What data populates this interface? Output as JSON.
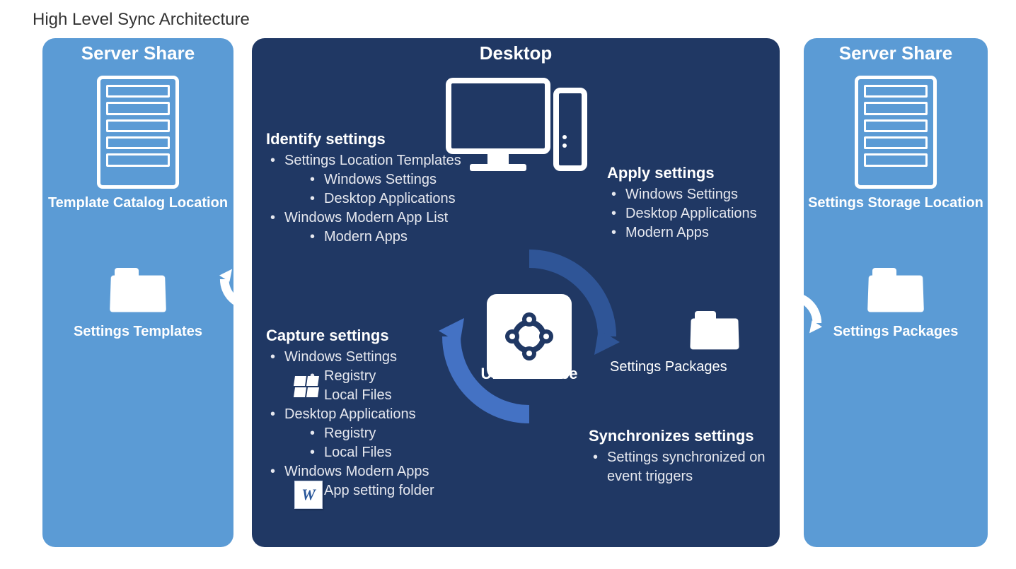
{
  "page_title": "High Level Sync Architecture",
  "left_panel": {
    "title": "Server Share",
    "top_label": "Template Catalog Location",
    "bottom_label": "Settings Templates"
  },
  "right_panel": {
    "title": "Server Share",
    "top_label": "Settings Storage Location",
    "bottom_label": "Settings Packages"
  },
  "center_panel": {
    "title": "Desktop",
    "uev_label": "UE-V Service",
    "settings_packages_label": "Settings Packages",
    "identify": {
      "title": "Identify settings",
      "items": [
        {
          "label": "Settings Location Templates",
          "children": [
            {
              "label": "Windows Settings"
            },
            {
              "label": "Desktop Applications"
            }
          ]
        },
        {
          "label": "Windows Modern App List",
          "children": [
            {
              "label": "Modern Apps"
            }
          ]
        }
      ]
    },
    "capture": {
      "title": "Capture settings",
      "items": [
        {
          "label": "Windows Settings",
          "icon": "windows-flag-icon",
          "children": [
            {
              "label": "Registry"
            },
            {
              "label": "Local Files"
            }
          ]
        },
        {
          "label": "Desktop Applications",
          "icon": "word-document-icon",
          "children": [
            {
              "label": "Registry"
            },
            {
              "label": "Local Files"
            }
          ]
        },
        {
          "label": "Windows Modern Apps",
          "children": [
            {
              "label": "App setting folder"
            }
          ]
        }
      ]
    },
    "apply": {
      "title": "Apply settings",
      "items": [
        {
          "label": "Windows Settings"
        },
        {
          "label": "Desktop Applications"
        },
        {
          "label": "Modern Apps"
        }
      ]
    },
    "sync": {
      "title": "Synchronizes settings",
      "items": [
        {
          "label": "Settings synchronized on event triggers"
        }
      ]
    }
  }
}
